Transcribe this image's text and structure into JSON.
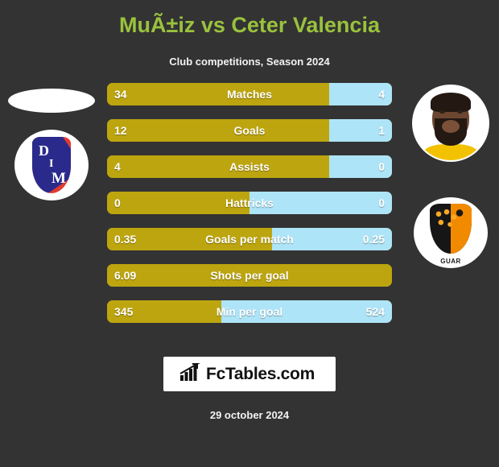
{
  "header": {
    "title": "MuÃ±iz vs Ceter Valencia",
    "subtitle": "Club competitions, Season 2024",
    "title_color": "#9ac23d"
  },
  "colors": {
    "background": "#333333",
    "left_player": "#bda50f",
    "right_player": "#aee4f7",
    "text": "#ffffff"
  },
  "left_side": {
    "photo_placeholder": "player-photo-placeholder",
    "crest_name": "independiente-medellin-crest",
    "crest_letters": {
      "d": "D",
      "i": "I",
      "m": "M"
    }
  },
  "right_side": {
    "photo_name": "ceter-valencia-photo",
    "crest_name": "aguilas-doradas-crest",
    "crest_text": "GUAR"
  },
  "chart_data": {
    "type": "bar",
    "title": "MuÃ±iz vs Ceter Valencia",
    "subtitle": "Club competitions, Season 2024",
    "orientation": "horizontal-split",
    "series": [
      {
        "name": "MuÃ±iz",
        "color": "#bda50f",
        "side": "left"
      },
      {
        "name": "Ceter Valencia",
        "color": "#aee4f7",
        "side": "right"
      }
    ],
    "categories": [
      "Matches",
      "Goals",
      "Assists",
      "Hattricks",
      "Goals per match",
      "Shots per goal",
      "Min per goal"
    ],
    "rows": [
      {
        "label": "Matches",
        "left": "34",
        "right": "4",
        "left_pct": 78,
        "right_pct": 22
      },
      {
        "label": "Goals",
        "left": "12",
        "right": "1",
        "left_pct": 78,
        "right_pct": 22
      },
      {
        "label": "Assists",
        "left": "4",
        "right": "0",
        "left_pct": 78,
        "right_pct": 22
      },
      {
        "label": "Hattricks",
        "left": "0",
        "right": "0",
        "left_pct": 50,
        "right_pct": 50
      },
      {
        "label": "Goals per match",
        "left": "0.35",
        "right": "0.25",
        "left_pct": 58,
        "right_pct": 42
      },
      {
        "label": "Shots per goal",
        "left": "6.09",
        "right": "",
        "left_pct": 100,
        "right_pct": 0
      },
      {
        "label": "Min per goal",
        "left": "345",
        "right": "524",
        "left_pct": 40,
        "right_pct": 60
      }
    ]
  },
  "footer": {
    "brand": "FcTables.com",
    "brand_icon": "bar-chart-icon",
    "date": "29 october 2024"
  }
}
